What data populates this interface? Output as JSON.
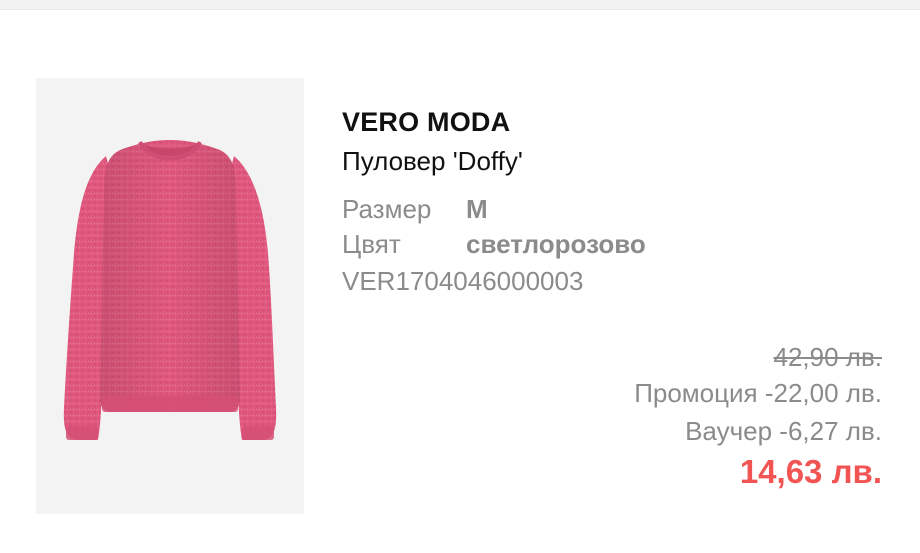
{
  "product": {
    "brand": "VERO MODA",
    "name": "Пуловер 'Doffy'",
    "image_alt": "pink knit sweater",
    "size": {
      "label": "Размер",
      "value": "M"
    },
    "color": {
      "label": "Цвят",
      "value": "светлорозово"
    },
    "sku": "VER1704046000003"
  },
  "pricing": {
    "old_price": "42,90 лв.",
    "promotion": "Промоция -22,00 лв.",
    "voucher": "Ваучер -6,27 лв.",
    "final_price": "14,63 лв."
  },
  "colors": {
    "final_price": "#f25454",
    "secondary_text": "#8b8b8b",
    "sweater": "#e0577d"
  }
}
